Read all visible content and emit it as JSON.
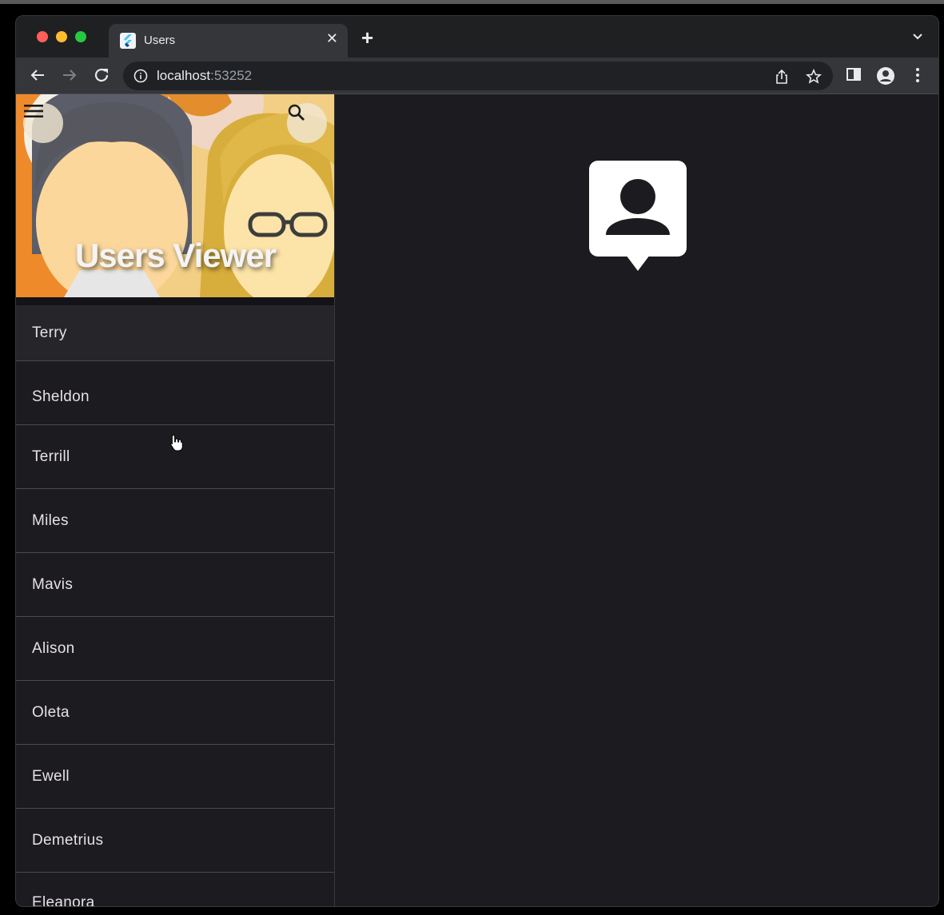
{
  "browser": {
    "tab_title": "Users",
    "url_host": "localhost",
    "url_port": ":53252"
  },
  "app": {
    "banner_title": "Users Viewer"
  },
  "users": [
    "Terry",
    "Sheldon",
    "Terrill",
    "Miles",
    "Mavis",
    "Alison",
    "Oleta",
    "Ewell",
    "Demetrius",
    "Eleanora"
  ],
  "colors": {
    "background": "#1c1b20",
    "divider": "#4b4a50",
    "selected_row": "#26252a",
    "text": "#e6e1e6"
  },
  "icons": {
    "menu": "hamburger-menu-icon",
    "search": "search-icon",
    "detail_placeholder": "contact-person-icon"
  }
}
